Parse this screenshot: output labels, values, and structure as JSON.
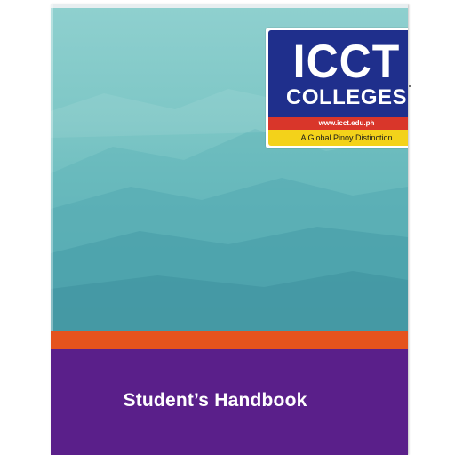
{
  "cover": {
    "title": "Student’s Handbook",
    "colors": {
      "teal": "#7ec7c6",
      "orange_band": "#e5531d",
      "purple_band": "#5a1f8a"
    }
  },
  "logo": {
    "line1": "ICCT",
    "line2": "COLLEGES",
    "url": "www.icct.edu.ph",
    "tagline": "A Global Pinoy Distinction",
    "colors": {
      "blue": "#1f2f8c",
      "red": "#d9362a",
      "yellow": "#f3d21a"
    }
  }
}
